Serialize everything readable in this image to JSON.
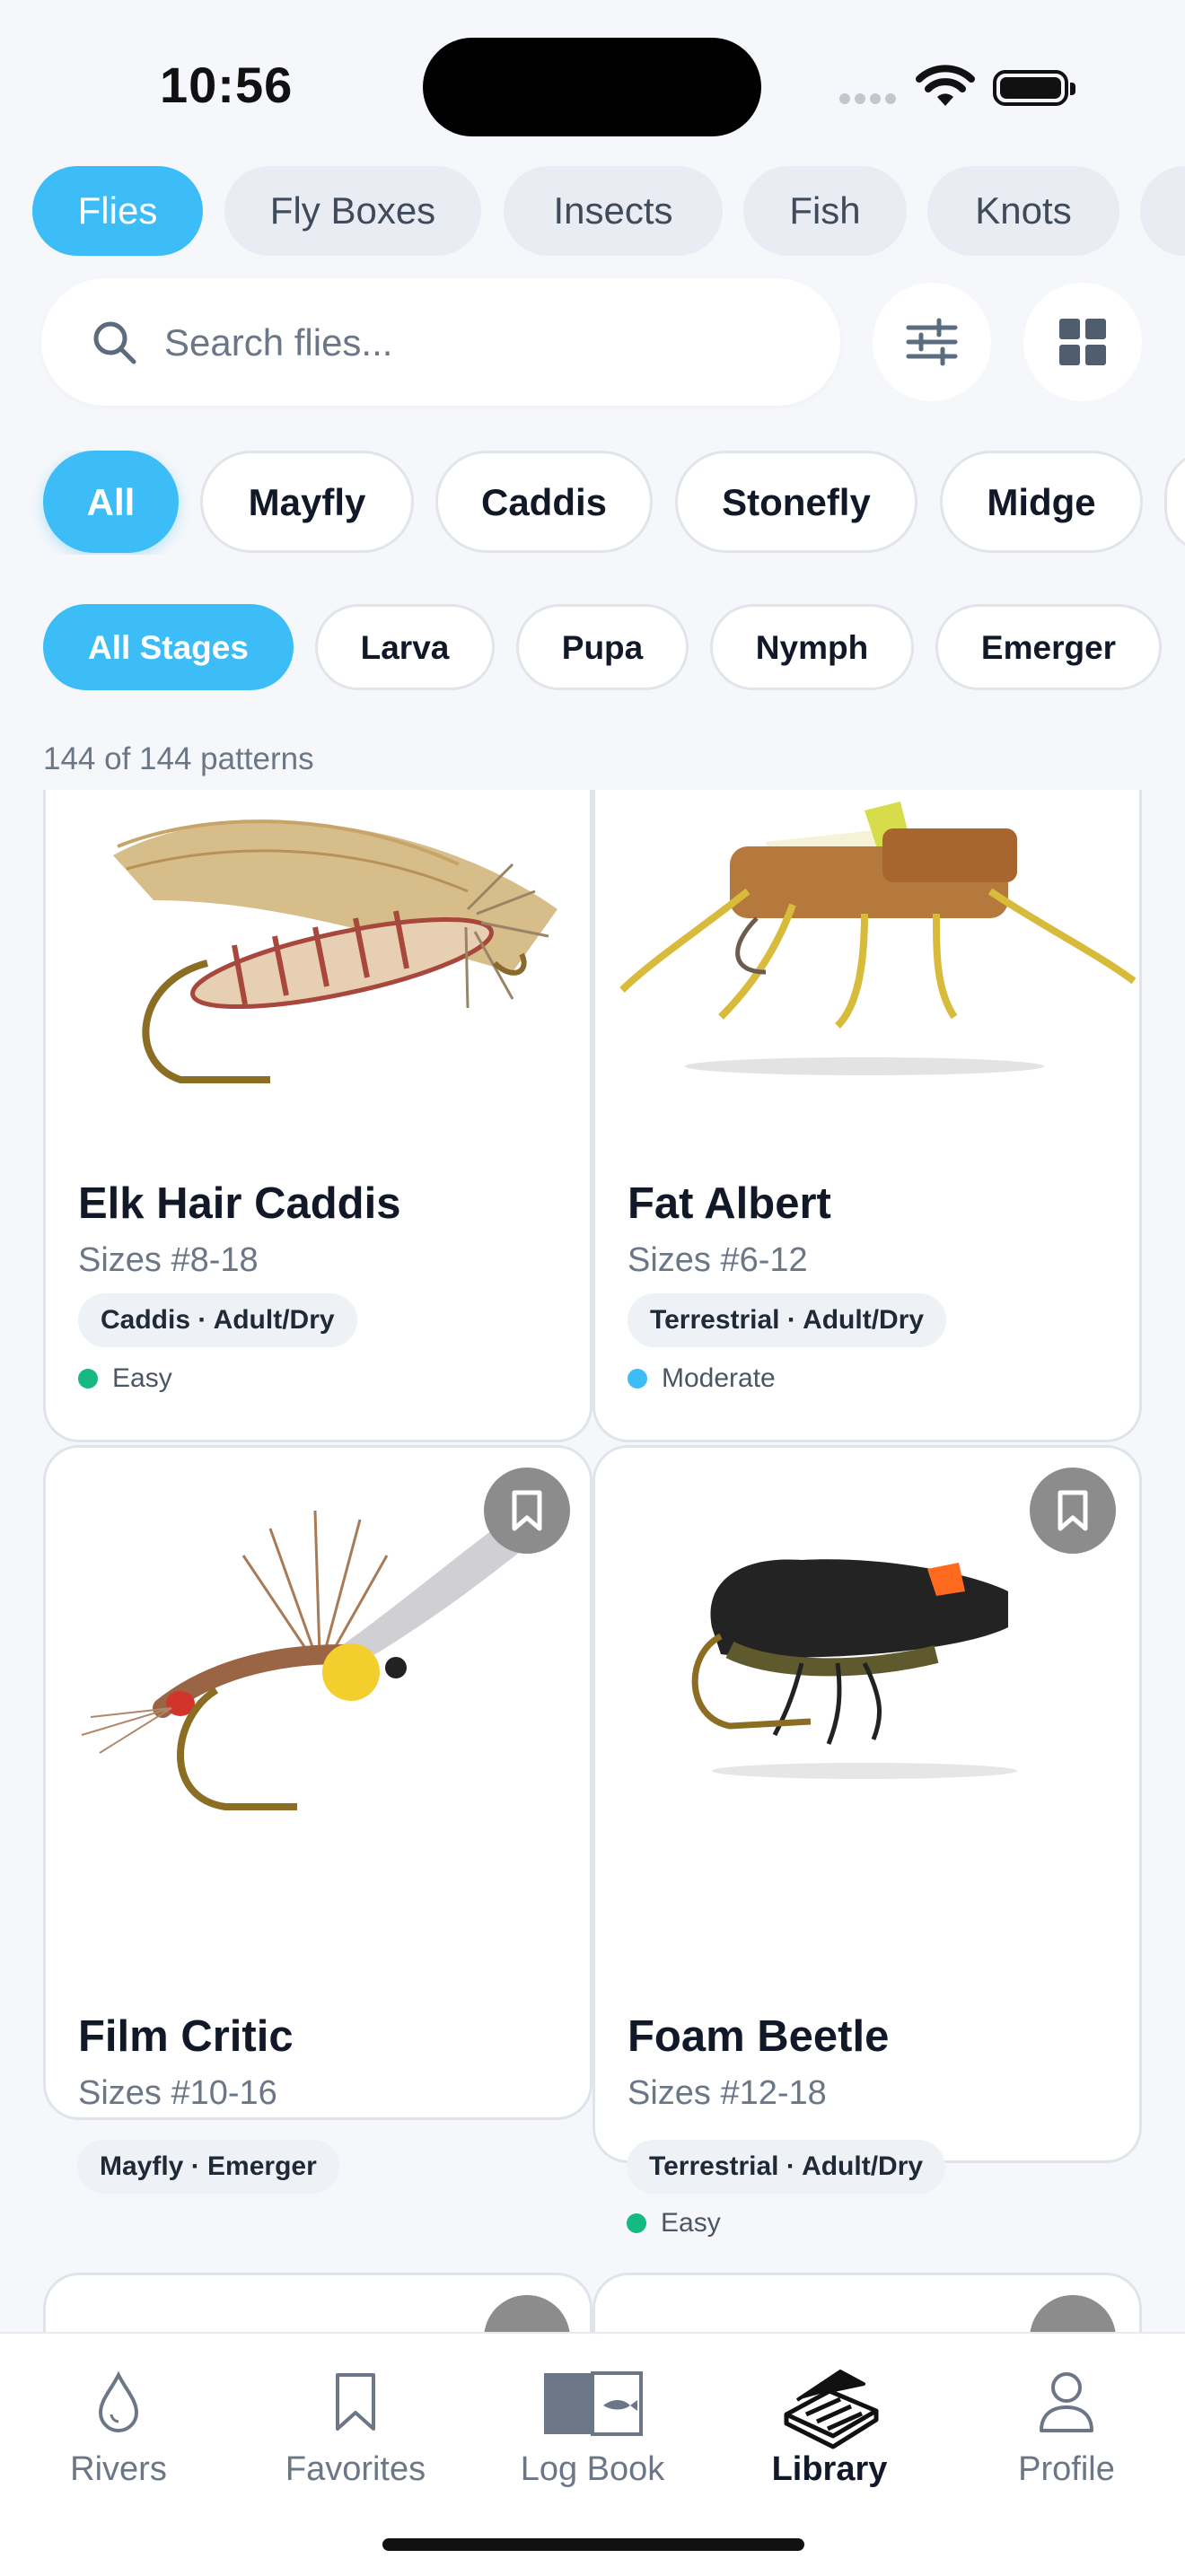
{
  "status": {
    "time": "10:56"
  },
  "category_tabs": [
    {
      "label": "Flies",
      "active": true
    },
    {
      "label": "Fly Boxes",
      "active": false
    },
    {
      "label": "Insects",
      "active": false
    },
    {
      "label": "Fish",
      "active": false
    },
    {
      "label": "Knots",
      "active": false
    }
  ],
  "search": {
    "placeholder": "Search flies...",
    "value": ""
  },
  "toolbar": {
    "filter_icon": "sliders-icon",
    "view_icon": "grid-view-icon"
  },
  "insect_types": [
    {
      "label": "All",
      "active": true
    },
    {
      "label": "Mayfly",
      "active": false
    },
    {
      "label": "Caddis",
      "active": false
    },
    {
      "label": "Stonefly",
      "active": false
    },
    {
      "label": "Midge",
      "active": false
    }
  ],
  "stages": [
    {
      "label": "All Stages",
      "active": true
    },
    {
      "label": "Larva",
      "active": false
    },
    {
      "label": "Pupa",
      "active": false
    },
    {
      "label": "Nymph",
      "active": false
    },
    {
      "label": "Emerger",
      "active": false
    }
  ],
  "results": {
    "count_text": "144 of 144 patterns"
  },
  "patterns": [
    {
      "name": "Elk Hair Caddis",
      "sizes": "Sizes #8-18",
      "tag": "Caddis · Adult/Dry",
      "difficulty": "Easy",
      "difficulty_color": "#16b981"
    },
    {
      "name": "Fat Albert",
      "sizes": "Sizes #6-12",
      "tag": "Terrestrial · Adult/Dry",
      "difficulty": "Moderate",
      "difficulty_color": "#3dbdf7"
    },
    {
      "name": "Film Critic",
      "sizes": "Sizes #10-16",
      "tag": "Mayfly · Emerger",
      "difficulty": "",
      "difficulty_color": ""
    },
    {
      "name": "Foam Beetle",
      "sizes": "Sizes #12-18",
      "tag": "Terrestrial · Adult/Dry",
      "difficulty": "Easy",
      "difficulty_color": "#16b981"
    }
  ],
  "tabbar": [
    {
      "label": "Rivers",
      "icon": "water-drop-icon",
      "active": false
    },
    {
      "label": "Favorites",
      "icon": "bookmark-icon",
      "active": false
    },
    {
      "label": "Log Book",
      "icon": "log-book-icon",
      "active": false
    },
    {
      "label": "Library",
      "icon": "fly-box-icon",
      "active": true
    },
    {
      "label": "Profile",
      "icon": "person-icon",
      "active": false
    }
  ],
  "colors": {
    "accent": "#3dbdf7",
    "easy": "#16b981",
    "moderate": "#3dbdf7",
    "background": "#f5f7fa"
  }
}
